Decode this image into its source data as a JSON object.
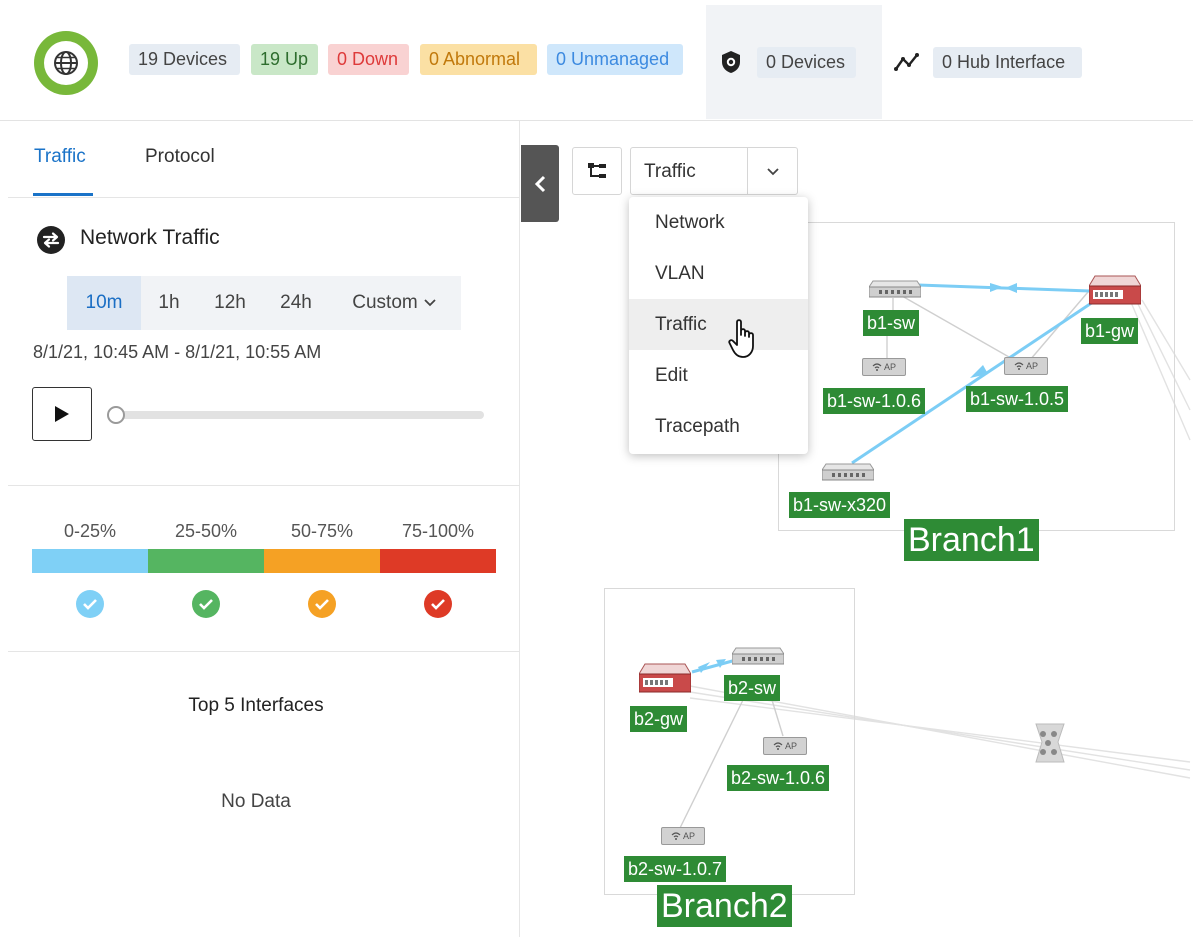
{
  "header": {
    "badges": {
      "devices": "19 Devices",
      "up": "19 Up",
      "down": "0 Down",
      "abnormal": "0 Abnormal",
      "unmanaged": "0 Unmanaged"
    },
    "hub": {
      "devices": "0 Devices",
      "hub_interface": "0 Hub Interface"
    }
  },
  "left": {
    "tabs": [
      {
        "label": "Traffic",
        "active": true
      },
      {
        "label": "Protocol",
        "active": false
      }
    ],
    "section_title": "Network Traffic",
    "time_ranges": [
      {
        "label": "10m",
        "active": true
      },
      {
        "label": "1h"
      },
      {
        "label": "12h"
      },
      {
        "label": "24h"
      },
      {
        "label": "Custom"
      }
    ],
    "date_range": "8/1/21, 10:45 AM - 8/1/21, 10:55 AM",
    "playback_progress": 0,
    "legend": [
      {
        "label": "0-25%",
        "color": "#7fd0f6"
      },
      {
        "label": "25-50%",
        "color": "#55b561"
      },
      {
        "label": "50-75%",
        "color": "#f5a124"
      },
      {
        "label": "75-100%",
        "color": "#de3a26"
      }
    ],
    "top_interfaces_title": "Top 5 Interfaces",
    "no_data": "No Data"
  },
  "topology": {
    "view_select": {
      "value": "Traffic"
    },
    "menu": [
      "Network",
      "VLAN",
      "Traffic",
      "Edit",
      "Tracepath"
    ],
    "menu_highlighted": "Traffic",
    "groups": [
      {
        "name": "Branch1"
      },
      {
        "name": "Branch2"
      }
    ],
    "devices": {
      "b1_sw": "b1-sw",
      "b1_gw": "b1-gw",
      "b1_sw_106": "b1-sw-1.0.6",
      "b1_sw_105": "b1-sw-1.0.5",
      "b1_sw_x320": "b1-sw-x320",
      "b2_sw": "b2-sw",
      "b2_gw": "b2-gw",
      "b2_sw_106": "b2-sw-1.0.6",
      "b2_sw_107": "b2-sw-1.0.7"
    },
    "ap_text": "AP"
  }
}
